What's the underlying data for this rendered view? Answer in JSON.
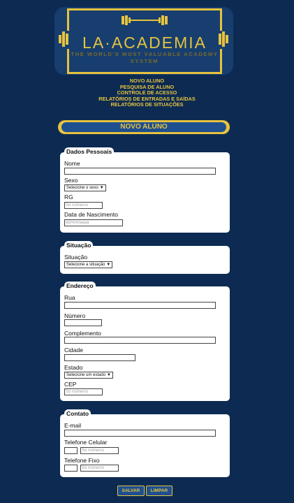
{
  "logo": {
    "title": "LA·ACADEMIA",
    "tagline_line1": "THE WORLD'S MOST VALUABLE ACADEMY",
    "tagline_line2": "SYSTEM",
    "accent": "#e6c33f"
  },
  "menu": {
    "items": [
      "NOVO ALUNO",
      "PESQUISA DE ALUNO",
      "CONTROLE DE ACESSO",
      "RELATÓRIOS DE ENTRADAS E SAÍDAS",
      "RELATÓRIOS DE SITUAÇÕES"
    ]
  },
  "banner": {
    "title": "NOVO ALUNO"
  },
  "dados_pessoais": {
    "legend": "Dados Pessoais",
    "nome_label": "Nome",
    "sexo_label": "Sexo",
    "sexo_select": "Selecione o sexo",
    "rg_label": "RG",
    "rg_placeholder": "Só números",
    "nascimento_label": "Data de Nascimento",
    "nascimento_placeholder": "dd/mm/aaaa"
  },
  "situacao": {
    "legend": "Situação",
    "label": "Situação",
    "select": "Selecione a situação"
  },
  "endereco": {
    "legend": "Endereço",
    "rua_label": "Rua",
    "numero_label": "Número",
    "complemento_label": "Complemento",
    "cidade_label": "Cidade",
    "estado_label": "Estado",
    "estado_select": "Selecione um estado",
    "cep_label": "CEP",
    "cep_placeholder": "Só números"
  },
  "contato": {
    "legend": "Contato",
    "email_label": "E-mail",
    "celular_label": "Telefone Celular",
    "celular_placeholder": "Só números",
    "fixo_label": "Telefone Fixo",
    "fixo_placeholder": "Só números"
  },
  "actions": {
    "save": "SALVAR",
    "clear": "LIMPAR"
  },
  "colors": {
    "background": "#0d2b52",
    "accent": "#e6c33f",
    "button": "#1e4f8f"
  }
}
